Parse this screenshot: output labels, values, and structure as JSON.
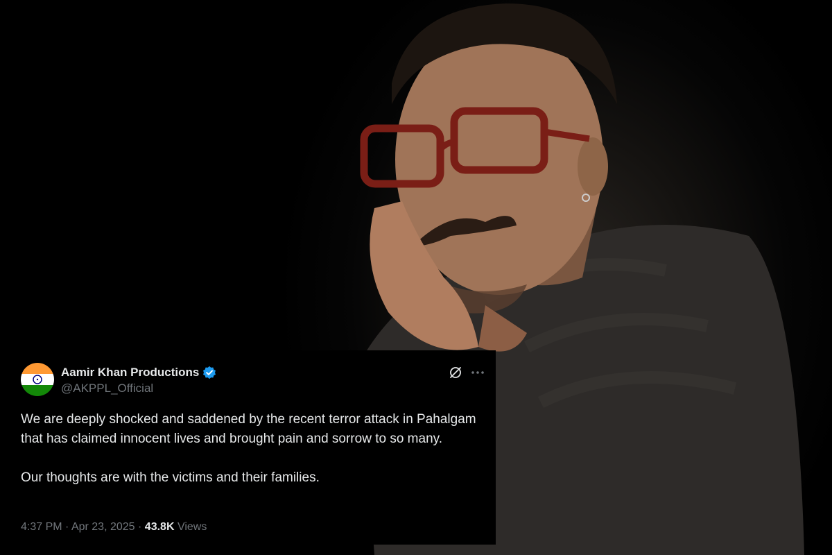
{
  "tweet": {
    "account_name": "Aamir Khan Productions",
    "handle": "@AKPPL_Official",
    "paragraphs": [
      "We are deeply shocked and saddened by the recent terror attack in Pahalgam that has claimed innocent lives and brought pain and sorrow to so many.",
      "Our thoughts are with the victims and their families."
    ],
    "time": "4:37 PM",
    "separator": "·",
    "date": "Apr 23, 2025",
    "views_count": "43.8K",
    "views_label": "Views",
    "avatar_icon": "india-flag-icon",
    "verified_icon": "verified-badge-icon",
    "actions": [
      "grok-icon",
      "more-options-icon"
    ]
  },
  "colors": {
    "background": "#000000",
    "text_primary": "#e7e9ea",
    "text_secondary": "#71767b",
    "verified_blue": "#1d9bf0",
    "flag_saffron": "#ff9933",
    "flag_green": "#138808",
    "flag_chakra": "#000080"
  }
}
